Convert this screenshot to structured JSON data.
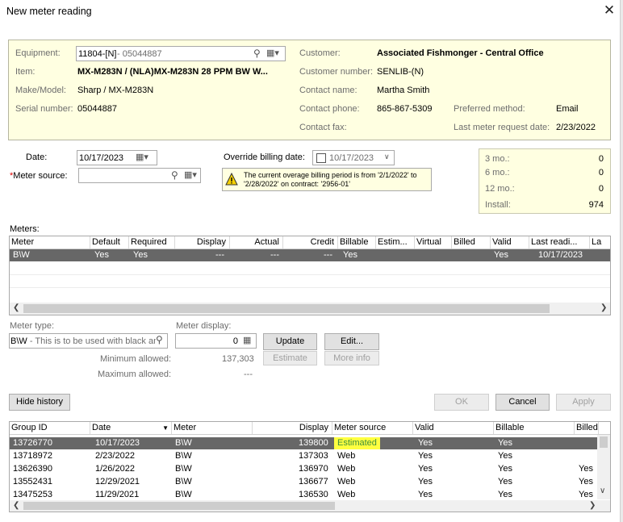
{
  "window": {
    "title": "New meter reading"
  },
  "equipment": {
    "equipment_label": "Equipment:",
    "equipment_value": "11804-[N]",
    "equipment_serial_suffix": " - 05044887",
    "item_label": "Item:",
    "item_value": "MX-M283N / (NLA)MX-M283N 28 PPM BW W...",
    "make_label": "Make/Model:",
    "make_value": "Sharp / MX-M283N",
    "serial_label": "Serial number:",
    "serial_value": "05044887"
  },
  "customer": {
    "customer_label": "Customer:",
    "customer_value": "Associated Fishmonger - Central Office",
    "number_label": "Customer number:",
    "number_value": "SENLIB-(N)",
    "contact_label": "Contact name:",
    "contact_value": "Martha Smith",
    "phone_label": "Contact phone:",
    "phone_value": "865-867-5309",
    "fax_label": "Contact fax:",
    "fax_value": "",
    "pref_label": "Preferred method:",
    "pref_value": "Email",
    "last_req_label": "Last meter request date:",
    "last_req_value": "2/23/2022"
  },
  "form": {
    "date_label": "Date:",
    "date_value": "10/17/2023",
    "source_label": "Meter source:",
    "source_value": "",
    "override_label": "Override billing date:",
    "override_value": "10/17/2023",
    "warning_text": "The current overage billing period is from '2/1/2022' to '2/28/2022' on contract: '2956-01'"
  },
  "stats": {
    "rows": [
      {
        "label": "3 mo.:",
        "value": "0"
      },
      {
        "label": "6 mo.:",
        "value": "0"
      },
      {
        "label": "12 mo.:",
        "value": "0"
      },
      {
        "label": "Install:",
        "value": "974"
      }
    ]
  },
  "meters": {
    "label": "Meters:",
    "headers": [
      "Meter",
      "Default",
      "Required",
      "Display",
      "Actual",
      "Credit",
      "Billable",
      "Estim...",
      "Virtual",
      "Billed",
      "Valid",
      "Last readi...",
      "La"
    ],
    "row": {
      "meter": "B\\W",
      "default": "Yes",
      "required": "Yes",
      "display": "---",
      "actual": "---",
      "credit": "---",
      "billable": "Yes",
      "valid": "Yes",
      "last": "10/17/2023"
    }
  },
  "meter_type": {
    "type_label": "Meter type:",
    "type_value": "B\\W",
    "type_desc": " - This is to be used with black an",
    "display_label": "Meter display:",
    "display_value": "0",
    "update_label": "Update",
    "edit_label": "Edit...",
    "estimate_label": "Estimate",
    "moreinfo_label": "More info",
    "min_label": "Minimum allowed:",
    "min_value": "137,303",
    "max_label": "Maximum allowed:",
    "max_value": "---"
  },
  "actions": {
    "hide_history": "Hide history",
    "ok": "OK",
    "cancel": "Cancel",
    "apply": "Apply"
  },
  "history": {
    "headers": [
      "Group ID",
      "Date",
      "Meter",
      "Display",
      "Meter source",
      "Valid",
      "Billable",
      "Billed"
    ],
    "rows": [
      {
        "group": "13726770",
        "date": "10/17/2023",
        "meter": "B\\W",
        "display": "139800",
        "source": "Estimated",
        "valid": "Yes",
        "billable": "Yes",
        "billed": ""
      },
      {
        "group": "13718972",
        "date": "2/23/2022",
        "meter": "B\\W",
        "display": "137303",
        "source": "Web",
        "valid": "Yes",
        "billable": "Yes",
        "billed": ""
      },
      {
        "group": "13626390",
        "date": "1/26/2022",
        "meter": "B\\W",
        "display": "136970",
        "source": "Web",
        "valid": "Yes",
        "billable": "Yes",
        "billed": "Yes"
      },
      {
        "group": "13552431",
        "date": "12/29/2021",
        "meter": "B\\W",
        "display": "136677",
        "source": "Web",
        "valid": "Yes",
        "billable": "Yes",
        "billed": "Yes"
      },
      {
        "group": "13475253",
        "date": "11/29/2021",
        "meter": "B\\W",
        "display": "136530",
        "source": "Web",
        "valid": "Yes",
        "billable": "Yes",
        "billed": "Yes"
      }
    ]
  },
  "colors": {
    "accent_highlight": "#ffff40",
    "selected_row": "#676767",
    "info_bg": "#ffffe1"
  }
}
